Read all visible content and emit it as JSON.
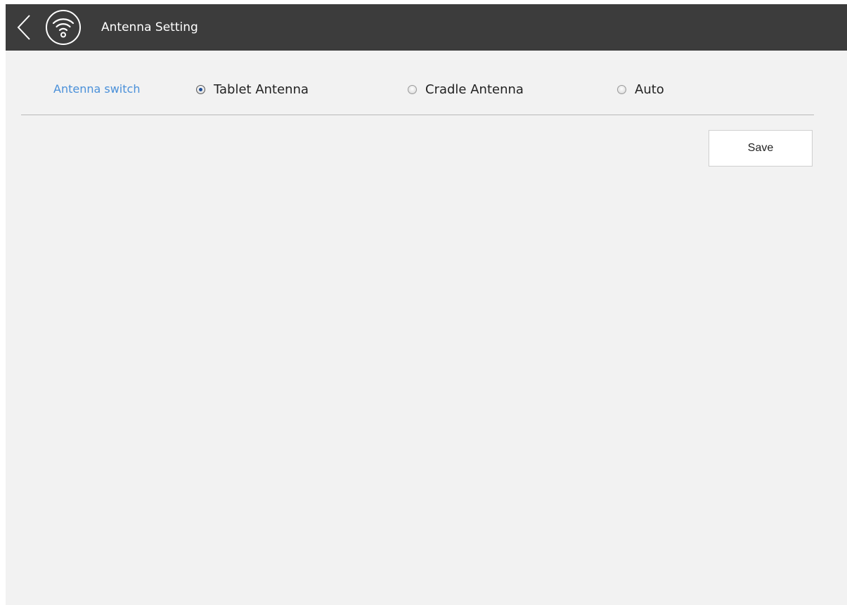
{
  "header": {
    "title": "Antenna Setting",
    "back_icon": "chevron-left-icon",
    "app_icon": "wifi-icon",
    "bg_color": "#3c3c3c"
  },
  "setting": {
    "label": "Antenna switch",
    "label_color": "#4a90d9",
    "options": [
      {
        "label": "Tablet Antenna",
        "selected": true
      },
      {
        "label": "Cradle Antenna",
        "selected": false
      },
      {
        "label": "Auto",
        "selected": false
      }
    ]
  },
  "actions": {
    "save_label": "Save"
  }
}
